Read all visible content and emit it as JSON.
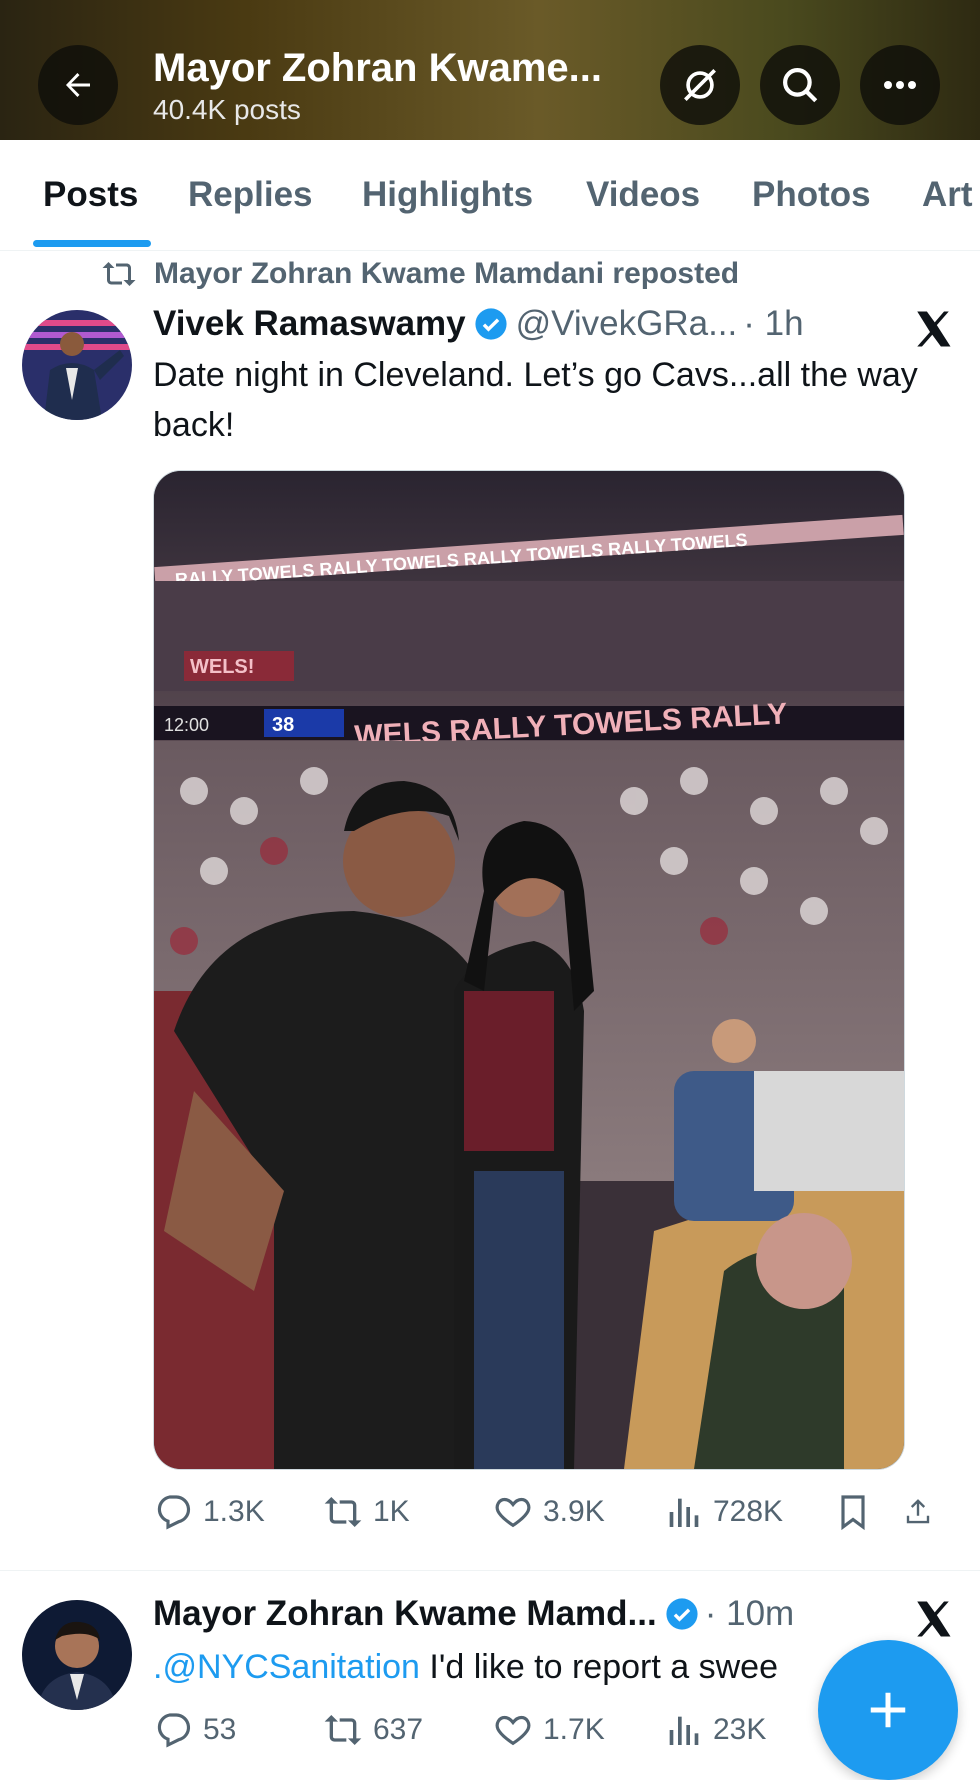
{
  "header": {
    "title": "Mayor Zohran Kwame...",
    "subtitle": "40.4K posts"
  },
  "tabs": [
    {
      "label": "Posts",
      "active": true
    },
    {
      "label": "Replies",
      "active": false
    },
    {
      "label": "Highlights",
      "active": false
    },
    {
      "label": "Videos",
      "active": false
    },
    {
      "label": "Photos",
      "active": false
    },
    {
      "label": "Art",
      "active": false
    }
  ],
  "post1": {
    "repost_label": "Mayor Zohran Kwame Mamdani reposted",
    "name": "Vivek Ramaswamy",
    "handle": "@VivekGRa...",
    "time": "· 1h",
    "text": "Date night in Cleveland. Let’s go Cavs...all the way back!",
    "photo": {
      "banner_top": "RALLY TOWELS RALLY TOWELS RALLY TOWELS RALLY TOWELS",
      "banner_mid": "WELS RALLY TOWELS RALLY",
      "scoreboard": "12:00",
      "score": "38",
      "left_sign": "WELS!"
    },
    "stats": {
      "replies": "1.3K",
      "reposts": "1K",
      "likes": "3.9K",
      "views": "728K"
    }
  },
  "post2": {
    "name": "Mayor Zohran Kwame Mamd...",
    "time": "· 10m",
    "mention": ".@NYCSanitation",
    "text": " I'd like to report a swee",
    "stats": {
      "replies": "53",
      "reposts": "637",
      "likes": "1.7K",
      "views": "23K"
    }
  },
  "colors": {
    "accent": "#1d9bf0",
    "text": "#0f1419",
    "secondary": "#536471"
  }
}
